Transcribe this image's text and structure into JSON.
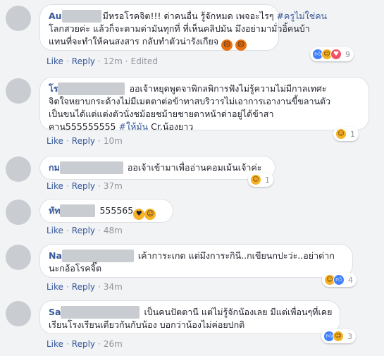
{
  "common": {
    "like": "Like",
    "reply": "Reply",
    "sep": "·",
    "edited": "Edited"
  },
  "comments": [
    {
      "name": "Au",
      "lines": [
        "มีหรอโรคจิต!!! ด่าคนอื่น รู้จักหมด เพจอะไรๆ",
        "โลกสวยค่ะ แล้วก็จะตามด่ามันทุกที่ ที่เห็นคลิปมัน มึงอย่ามามั่วอิ้คนบ้า",
        "แทนที่จะทำให้คนสงสาร กลับทำตัวน่ารังเกียจ"
      ],
      "hashtag": "#ครูไม่ใช่คน",
      "time": "12m",
      "reaction_count": "9",
      "colors": {
        "angry": "#e9710f"
      }
    },
    {
      "name": "โร",
      "lines": [
        "ออเจ้าหยุดพูดจาพิกลพิการฟังไม่รู้ความไม่มีกาลเทศะ",
        "จิตใจหยาบกระด้างไม่มีเมตตาต่อข้าทาสบริวารไม่เอาการเอางานขี้ขลานตัว",
        "เป็นขนได้แต่แต่งตัวนั่งชม้อยชม้ายชายตาหน้าด่าอยู่ได้ข้าสา",
        "คาน555555555"
      ],
      "hashtag": "#ให้มัน",
      "credit": "Cr.น้องยาว",
      "time": "10m",
      "reaction_count": "1"
    },
    {
      "name": "กม",
      "text": "ออเจ้าเข้ามาเพื่ออ่านคอมเม้นเจ้าค่ะ",
      "time": "37m",
      "reaction_count": "1"
    },
    {
      "name": "หัท",
      "text": "555565",
      "time": "48m"
    },
    {
      "name": "Na",
      "lines": [
        "เค้าการะเกด แต่มึงการะกินี..กเขียนกปะว่ะ..อย่าด่าก",
        "นะกอ้อโรคจิ๊ต"
      ],
      "time": "34m",
      "reaction_count": "4"
    },
    {
      "name": "Sa",
      "lines": [
        "เป็นคนปัตตานี แต่ไม่รู้จักน้องเลย มีแต่เพื่อนๆที่เคย",
        "เรียนโรงเรียนเดียวกันกับน้อง บอกว่าน้องไม่ค่อยปกติ"
      ],
      "time": "26m",
      "reaction_count": "3"
    }
  ]
}
